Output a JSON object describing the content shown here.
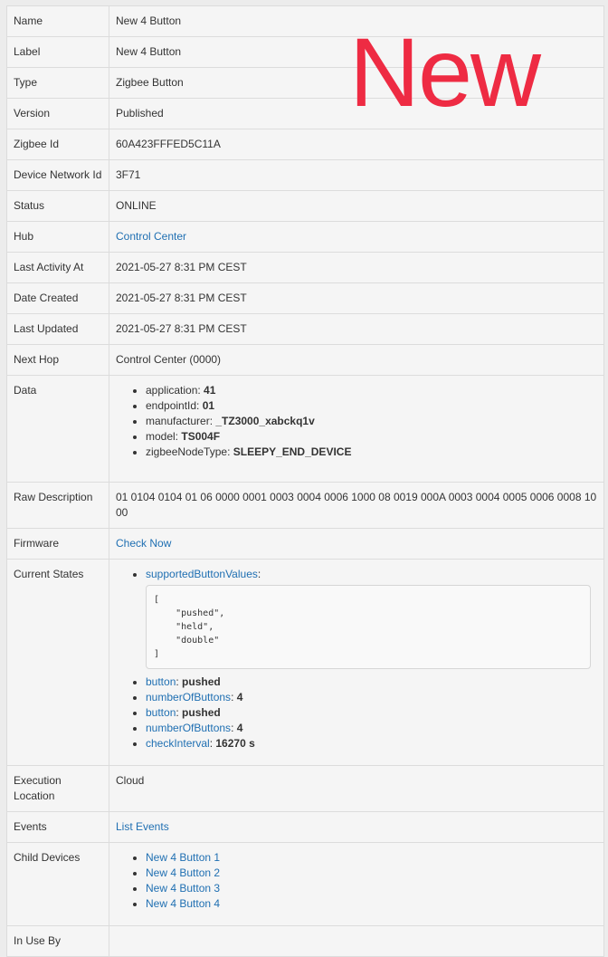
{
  "overlay_text": "New",
  "rows": {
    "name": {
      "label": "Name",
      "value": "New 4 Button"
    },
    "label": {
      "label": "Label",
      "value": "New 4 Button"
    },
    "type": {
      "label": "Type",
      "value": "Zigbee Button"
    },
    "version": {
      "label": "Version",
      "value": "Published"
    },
    "zigbee_id": {
      "label": "Zigbee Id",
      "value": "60A423FFFED5C11A"
    },
    "network_id": {
      "label": "Device Network Id",
      "value": "3F71"
    },
    "status": {
      "label": "Status",
      "value": "ONLINE"
    },
    "hub": {
      "label": "Hub",
      "value": "Control Center"
    },
    "last_activity": {
      "label": "Last Activity At",
      "value": "2021-05-27 8:31 PM CEST"
    },
    "date_created": {
      "label": "Date Created",
      "value": "2021-05-27 8:31 PM CEST"
    },
    "last_updated": {
      "label": "Last Updated",
      "value": "2021-05-27 8:31 PM CEST"
    },
    "next_hop": {
      "label": "Next Hop",
      "value": "Control Center (0000)"
    },
    "data": {
      "label": "Data",
      "items": [
        {
          "key": "application: ",
          "value": "41"
        },
        {
          "key": "endpointId: ",
          "value": "01"
        },
        {
          "key": "manufacturer: ",
          "value": "_TZ3000_xabckq1v"
        },
        {
          "key": "model: ",
          "value": "TS004F"
        },
        {
          "key": "zigbeeNodeType: ",
          "value": "SLEEPY_END_DEVICE"
        }
      ]
    },
    "raw_description": {
      "label": "Raw Description",
      "value": "01 0104 0104 01 06 0000 0001 0003 0004 0006 1000 08 0019 000A 0003 0004 0005 0006 0008 1000"
    },
    "firmware": {
      "label": "Firmware",
      "value": "Check Now"
    },
    "current_states": {
      "label": "Current States",
      "supported": {
        "key": "supportedButtonValues",
        "sep": ":",
        "json": "[\n    \"pushed\",\n    \"held\",\n    \"double\"\n]"
      },
      "items": [
        {
          "key": "button",
          "sep": ": ",
          "value": "pushed"
        },
        {
          "key": "numberOfButtons",
          "sep": ": ",
          "value": "4"
        },
        {
          "key": "button",
          "sep": ": ",
          "value": "pushed"
        },
        {
          "key": "numberOfButtons",
          "sep": ": ",
          "value": "4"
        },
        {
          "key": "checkInterval",
          "sep": ": ",
          "value": "16270 s"
        }
      ]
    },
    "execution_location": {
      "label": "Execution Location",
      "value": "Cloud"
    },
    "events": {
      "label": "Events",
      "value": "List Events"
    },
    "child_devices": {
      "label": "Child Devices",
      "items": [
        "New 4 Button 1",
        "New 4 Button 2",
        "New 4 Button 3",
        "New 4 Button 4"
      ]
    },
    "in_use_by": {
      "label": "In Use By",
      "value": ""
    }
  }
}
